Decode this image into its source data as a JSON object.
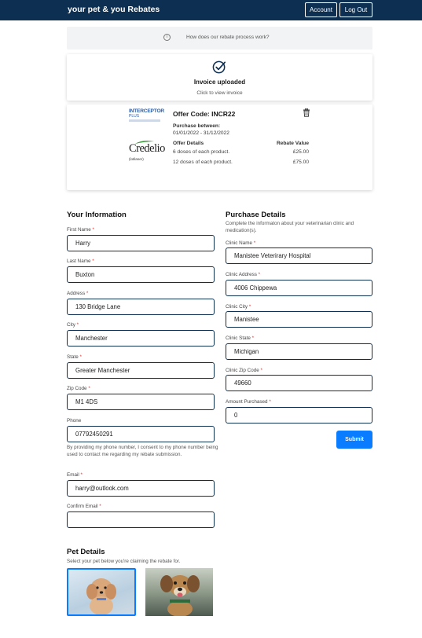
{
  "header": {
    "brand": "your pet & you Rebates",
    "account_label": "Account",
    "logout_label": "Log Out"
  },
  "info_bar": {
    "text": "How does our rebate process work?"
  },
  "invoice": {
    "title": "Invoice uploaded",
    "subtitle": "Click to view invoice"
  },
  "offer": {
    "logo1_text": "INTERCEPTOR",
    "logo1_sub": "PLUS",
    "logo2_text": "Credelio",
    "logo2_sub": "(lotilaner)",
    "code": "Offer Code: INCR22",
    "purchase_label": "Purchase between:",
    "purchase_dates": "01/01/2022 - 31/12/2022",
    "details_header": "Offer Details",
    "value_header": "Rebate Value",
    "rows": [
      {
        "detail": "6 doses of each product.",
        "value": "£25.00"
      },
      {
        "detail": "12 doses of each product.",
        "value": "£75.00"
      }
    ]
  },
  "your_info": {
    "title": "Your Information",
    "fields": {
      "first_name": {
        "label": "First Name",
        "value": "Harry"
      },
      "last_name": {
        "label": "Last Name",
        "value": "Buxton"
      },
      "address": {
        "label": "Address",
        "value": "130 Bridge Lane"
      },
      "city": {
        "label": "City",
        "value": "Manchester"
      },
      "state": {
        "label": "State",
        "value": "Greater Manchester"
      },
      "zip": {
        "label": "Zip Code",
        "value": "M1 4DS"
      },
      "phone": {
        "label": "Phone",
        "value": "07792450291"
      },
      "email": {
        "label": "Email",
        "value": "harry@outlook.com"
      },
      "confirm_email": {
        "label": "Confirm Email",
        "value": ""
      }
    },
    "phone_consent": "By providing my phone number, I consent to my phone number being used to contact me regarding my rebate submission."
  },
  "purchase_details": {
    "title": "Purchase Details",
    "description": "Complete the informaton about your veterinarian clinic and medication(s).",
    "fields": {
      "clinic_name": {
        "label": "Clinic Name",
        "value": "Manistee Veterirary Hospital"
      },
      "clinic_address": {
        "label": "Clinic Address",
        "value": "4006 Chippewa"
      },
      "clinic_city": {
        "label": "Clinic City",
        "value": "Manistee"
      },
      "clinic_state": {
        "label": "Clinic State",
        "value": "Michigan"
      },
      "clinic_zip": {
        "label": "Clinic Zip Code",
        "value": "49660"
      },
      "amount": {
        "label": "Amount Purchased",
        "value": "0"
      }
    },
    "submit_label": "Submit"
  },
  "pet_details": {
    "title": "Pet Details",
    "subtitle": "Select your pet below you're claiming the rebate for."
  },
  "colors": {
    "navbar": "#0d2f52",
    "accent": "#0a7cff",
    "required": "#dd3333"
  }
}
